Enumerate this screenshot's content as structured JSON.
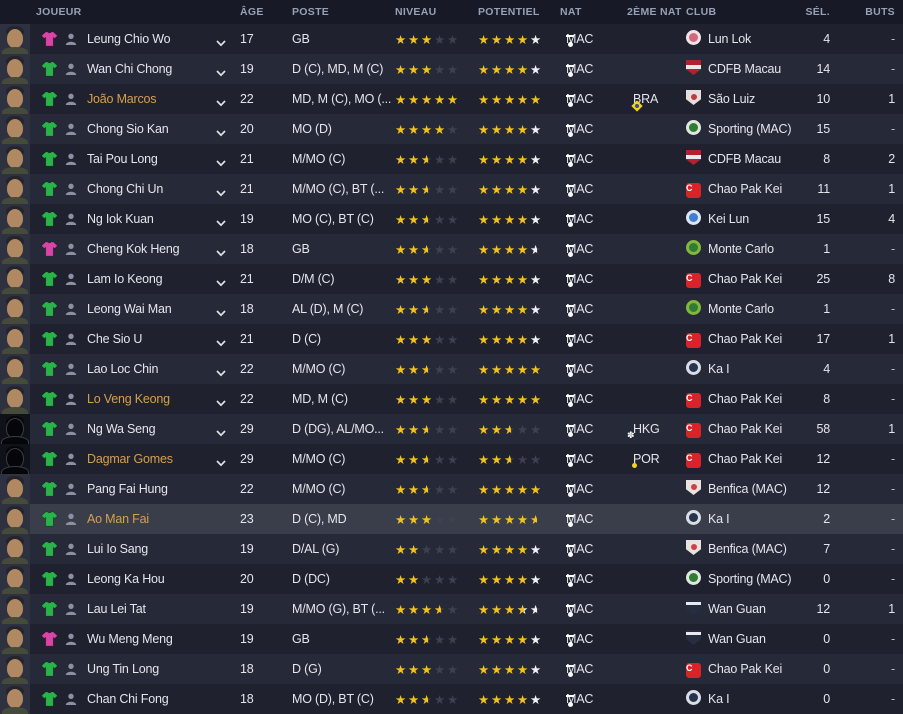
{
  "header": {
    "joueur": "JOUEUR",
    "age": "ÂGE",
    "poste": "POSTE",
    "niveau": "NIVEAU",
    "potentiel": "POTENTIEL",
    "nat": "NAT",
    "nat2": "2ÈME NAT",
    "club": "CLUB",
    "sel": "SÉL.",
    "buts": "BUTS"
  },
  "colors": {
    "gold_star": "#f2c21d",
    "white_star": "#f1f3f5",
    "empty_star": "#3d4150",
    "orange_name": "#d6a04b",
    "green_shirt": "#2ab34a",
    "pink_shirt": "#d944a7",
    "row_dark": "#1f212f",
    "row_light": "#262938",
    "row_highlight": "#3a3e4a",
    "header_bg": "#171926",
    "header_text": "#97a0b4",
    "text": "#e3e6ec"
  },
  "flags": {
    "MAC": {
      "bg": "#00795c"
    },
    "BRA": {
      "bg": "#0f9e49",
      "diamond": "#f7d117",
      "circle": "#2a4fa2"
    },
    "HKG": {
      "bg": "#d8232a"
    },
    "POR": {
      "green": "#0a6b3c",
      "red": "#d8232a",
      "circle": "#f7d117"
    }
  },
  "badges": {
    "lunlok": {
      "shape": "circle",
      "c1": "#efe3e6",
      "c2": "#d2687f"
    },
    "cdfb": {
      "shape": "shield",
      "c1": "#b3212e",
      "c2": "#e8e8ea"
    },
    "saoluiz": {
      "shape": "shield",
      "c1": "#e6dede",
      "c2": "#c23b3b",
      "center": true
    },
    "sporting": {
      "shape": "circle",
      "c1": "#dfe7df",
      "c2": "#2e7d32"
    },
    "cpk": {
      "shape": "square",
      "c1": "#d8232a",
      "glyph": "C"
    },
    "keilun": {
      "shape": "circle",
      "c1": "#dde6f0",
      "c2": "#3f7fd1"
    },
    "montecarlo": {
      "shape": "circle",
      "c1": "#84b53e",
      "c2": "#2e7d32"
    },
    "kai": {
      "shape": "circle",
      "c1": "#d8dde6",
      "c2": "#27344f"
    },
    "benfica": {
      "shape": "shield",
      "c1": "#e9e2df",
      "c2": "#cc4246",
      "center": true
    },
    "wanguan": {
      "shape": "shield",
      "c1": "#272d41",
      "c2": "#e8eaf0",
      "top": true
    }
  },
  "players": [
    {
      "name": "Leung Chio Wo",
      "name_style": "normal",
      "shirt": "pink",
      "portrait": "face",
      "dropdown": true,
      "age": "17",
      "poste": "GB",
      "niveau": [
        "g",
        "g",
        "g",
        "e",
        "e"
      ],
      "potentiel": [
        "g",
        "g",
        "g",
        "g",
        "w"
      ],
      "nat": "MAC",
      "nat2": "",
      "club": "Lun Lok",
      "badge": "lunlok",
      "sel": "4",
      "buts": "-",
      "highlighted": false
    },
    {
      "name": "Wan Chi Chong",
      "name_style": "normal",
      "shirt": "green",
      "portrait": "face",
      "dropdown": true,
      "age": "19",
      "poste": "D (C), MD, M (C)",
      "niveau": [
        "g",
        "g",
        "g",
        "e",
        "e"
      ],
      "potentiel": [
        "g",
        "g",
        "g",
        "g",
        "w"
      ],
      "nat": "MAC",
      "nat2": "",
      "club": "CDFB Macau",
      "badge": "cdfb",
      "sel": "14",
      "buts": "-",
      "highlighted": false
    },
    {
      "name": "João Marcos",
      "name_style": "orange",
      "shirt": "green",
      "portrait": "face",
      "dropdown": true,
      "age": "22",
      "poste": "MD, M (C), MO (...",
      "niveau": [
        "g",
        "g",
        "g",
        "g",
        "g"
      ],
      "potentiel": [
        "g",
        "g",
        "g",
        "g",
        "g"
      ],
      "nat": "MAC",
      "nat2": "BRA",
      "club": "São Luiz",
      "badge": "saoluiz",
      "sel": "10",
      "buts": "1",
      "highlighted": false
    },
    {
      "name": "Chong Sio Kan",
      "name_style": "normal",
      "shirt": "green",
      "portrait": "face",
      "dropdown": true,
      "age": "20",
      "poste": "MO (D)",
      "niveau": [
        "g",
        "g",
        "g",
        "g",
        "e"
      ],
      "potentiel": [
        "g",
        "g",
        "g",
        "g",
        "w"
      ],
      "nat": "MAC",
      "nat2": "",
      "club": "Sporting (MAC)",
      "badge": "sporting",
      "sel": "15",
      "buts": "-",
      "highlighted": false
    },
    {
      "name": "Tai Pou Long",
      "name_style": "normal",
      "shirt": "green",
      "portrait": "face",
      "dropdown": true,
      "age": "21",
      "poste": "M/MO (C)",
      "niveau": [
        "g",
        "g",
        "gh",
        "e",
        "e"
      ],
      "potentiel": [
        "g",
        "g",
        "g",
        "g",
        "w"
      ],
      "nat": "MAC",
      "nat2": "",
      "club": "CDFB Macau",
      "badge": "cdfb",
      "sel": "8",
      "buts": "2",
      "highlighted": false
    },
    {
      "name": "Chong Chi Un",
      "name_style": "normal",
      "shirt": "green",
      "portrait": "face",
      "dropdown": true,
      "age": "21",
      "poste": "M/MO (C), BT (...",
      "niveau": [
        "g",
        "g",
        "gh",
        "e",
        "e"
      ],
      "potentiel": [
        "g",
        "g",
        "g",
        "g",
        "w"
      ],
      "nat": "MAC",
      "nat2": "",
      "club": "Chao Pak Kei",
      "badge": "cpk",
      "sel": "11",
      "buts": "1",
      "highlighted": false
    },
    {
      "name": "Ng Iok Kuan",
      "name_style": "normal",
      "shirt": "green",
      "portrait": "face",
      "dropdown": true,
      "age": "19",
      "poste": "MO (C), BT (C)",
      "niveau": [
        "g",
        "g",
        "gh",
        "e",
        "e"
      ],
      "potentiel": [
        "g",
        "g",
        "g",
        "g",
        "w"
      ],
      "nat": "MAC",
      "nat2": "",
      "club": "Kei Lun",
      "badge": "keilun",
      "sel": "15",
      "buts": "4",
      "highlighted": false
    },
    {
      "name": "Cheng Kok Heng",
      "name_style": "normal",
      "shirt": "pink",
      "portrait": "face",
      "dropdown": true,
      "age": "18",
      "poste": "GB",
      "niveau": [
        "g",
        "g",
        "gh",
        "e",
        "e"
      ],
      "potentiel": [
        "g",
        "g",
        "g",
        "g",
        "wh"
      ],
      "nat": "MAC",
      "nat2": "",
      "club": "Monte Carlo",
      "badge": "montecarlo",
      "sel": "1",
      "buts": "-",
      "highlighted": false
    },
    {
      "name": "Lam Io Keong",
      "name_style": "normal",
      "shirt": "green",
      "portrait": "face",
      "dropdown": true,
      "age": "21",
      "poste": "D/M (C)",
      "niveau": [
        "g",
        "g",
        "g",
        "e",
        "e"
      ],
      "potentiel": [
        "g",
        "g",
        "g",
        "g",
        "w"
      ],
      "nat": "MAC",
      "nat2": "",
      "club": "Chao Pak Kei",
      "badge": "cpk",
      "sel": "25",
      "buts": "8",
      "highlighted": false
    },
    {
      "name": "Leong Wai Man",
      "name_style": "normal",
      "shirt": "green",
      "portrait": "face",
      "dropdown": true,
      "age": "18",
      "poste": "AL (D), M (C)",
      "niveau": [
        "g",
        "g",
        "gh",
        "e",
        "e"
      ],
      "potentiel": [
        "g",
        "g",
        "g",
        "g",
        "w"
      ],
      "nat": "MAC",
      "nat2": "",
      "club": "Monte Carlo",
      "badge": "montecarlo",
      "sel": "1",
      "buts": "-",
      "highlighted": false
    },
    {
      "name": "Che Sio U",
      "name_style": "normal",
      "shirt": "green",
      "portrait": "face",
      "dropdown": true,
      "age": "21",
      "poste": "D (C)",
      "niveau": [
        "g",
        "g",
        "g",
        "e",
        "e"
      ],
      "potentiel": [
        "g",
        "g",
        "g",
        "g",
        "w"
      ],
      "nat": "MAC",
      "nat2": "",
      "club": "Chao Pak Kei",
      "badge": "cpk",
      "sel": "17",
      "buts": "1",
      "highlighted": false
    },
    {
      "name": "Lao Loc Chin",
      "name_style": "normal",
      "shirt": "green",
      "portrait": "face",
      "dropdown": true,
      "age": "22",
      "poste": "M/MO (C)",
      "niveau": [
        "g",
        "g",
        "gh",
        "e",
        "e"
      ],
      "potentiel": [
        "g",
        "g",
        "g",
        "g",
        "g"
      ],
      "nat": "MAC",
      "nat2": "",
      "club": "Ka I",
      "badge": "kai",
      "sel": "4",
      "buts": "-",
      "highlighted": false
    },
    {
      "name": "Lo Veng Keong",
      "name_style": "orange",
      "shirt": "green",
      "portrait": "face",
      "dropdown": true,
      "age": "22",
      "poste": "MD, M (C)",
      "niveau": [
        "g",
        "g",
        "g",
        "e",
        "e"
      ],
      "potentiel": [
        "g",
        "g",
        "g",
        "g",
        "g"
      ],
      "nat": "MAC",
      "nat2": "",
      "club": "Chao Pak Kei",
      "badge": "cpk",
      "sel": "8",
      "buts": "-",
      "highlighted": false
    },
    {
      "name": "Ng Wa Seng",
      "name_style": "normal",
      "shirt": "green",
      "portrait": "silhouette",
      "dropdown": true,
      "age": "29",
      "poste": "D (DG), AL/MO...",
      "niveau": [
        "g",
        "g",
        "gh",
        "e",
        "e"
      ],
      "potentiel": [
        "g",
        "g",
        "gh",
        "e",
        "e"
      ],
      "nat": "MAC",
      "nat2": "HKG",
      "club": "Chao Pak Kei",
      "badge": "cpk",
      "sel": "58",
      "buts": "1",
      "highlighted": false
    },
    {
      "name": "Dagmar Gomes",
      "name_style": "orange",
      "shirt": "green",
      "portrait": "silhouette",
      "dropdown": true,
      "age": "29",
      "poste": "M/MO (C)",
      "niveau": [
        "g",
        "g",
        "gh",
        "e",
        "e"
      ],
      "potentiel": [
        "g",
        "g",
        "gh",
        "e",
        "e"
      ],
      "nat": "MAC",
      "nat2": "POR",
      "club": "Chao Pak Kei",
      "badge": "cpk",
      "sel": "12",
      "buts": "-",
      "highlighted": false
    },
    {
      "name": "Pang Fai Hung",
      "name_style": "normal",
      "shirt": "green",
      "portrait": "face",
      "dropdown": false,
      "age": "22",
      "poste": "M/MO (C)",
      "niveau": [
        "g",
        "g",
        "gh",
        "e",
        "e"
      ],
      "potentiel": [
        "g",
        "g",
        "g",
        "g",
        "g"
      ],
      "nat": "MAC",
      "nat2": "",
      "club": "Benfica (MAC)",
      "badge": "benfica",
      "sel": "12",
      "buts": "-",
      "highlighted": false
    },
    {
      "name": "Ao Man Fai",
      "name_style": "orange",
      "shirt": "green",
      "portrait": "face",
      "dropdown": false,
      "age": "23",
      "poste": "D (C), MD",
      "niveau": [
        "g",
        "g",
        "g",
        "e",
        "e"
      ],
      "potentiel": [
        "g",
        "g",
        "g",
        "g",
        "gh"
      ],
      "nat": "MAC",
      "nat2": "",
      "club": "Ka I",
      "badge": "kai",
      "sel": "2",
      "buts": "-",
      "highlighted": true
    },
    {
      "name": "Lui Io Sang",
      "name_style": "normal",
      "shirt": "green",
      "portrait": "face",
      "dropdown": false,
      "age": "19",
      "poste": "D/AL (G)",
      "niveau": [
        "g",
        "g",
        "e",
        "e",
        "e"
      ],
      "potentiel": [
        "g",
        "g",
        "g",
        "g",
        "w"
      ],
      "nat": "MAC",
      "nat2": "",
      "club": "Benfica (MAC)",
      "badge": "benfica",
      "sel": "7",
      "buts": "-",
      "highlighted": false
    },
    {
      "name": "Leong Ka Hou",
      "name_style": "normal",
      "shirt": "green",
      "portrait": "face",
      "dropdown": false,
      "age": "20",
      "poste": "D (DC)",
      "niveau": [
        "g",
        "g",
        "e",
        "e",
        "e"
      ],
      "potentiel": [
        "g",
        "g",
        "g",
        "g",
        "w"
      ],
      "nat": "MAC",
      "nat2": "",
      "club": "Sporting (MAC)",
      "badge": "sporting",
      "sel": "0",
      "buts": "-",
      "highlighted": false
    },
    {
      "name": "Lau Lei Tat",
      "name_style": "normal",
      "shirt": "green",
      "portrait": "face",
      "dropdown": false,
      "age": "19",
      "poste": "M/MO (G), BT (...",
      "niveau": [
        "g",
        "g",
        "g",
        "gh",
        "e"
      ],
      "potentiel": [
        "g",
        "g",
        "g",
        "gw",
        "wh"
      ],
      "nat": "MAC",
      "nat2": "",
      "club": "Wan Guan",
      "badge": "wanguan",
      "sel": "12",
      "buts": "1",
      "highlighted": false
    },
    {
      "name": "Wu Meng Meng",
      "name_style": "normal",
      "shirt": "pink",
      "portrait": "face",
      "dropdown": false,
      "age": "19",
      "poste": "GB",
      "niveau": [
        "g",
        "g",
        "gh",
        "e",
        "e"
      ],
      "potentiel": [
        "g",
        "g",
        "g",
        "g",
        "w"
      ],
      "nat": "MAC",
      "nat2": "",
      "club": "Wan Guan",
      "badge": "wanguan",
      "sel": "0",
      "buts": "-",
      "highlighted": false
    },
    {
      "name": "Ung Tin Long",
      "name_style": "normal",
      "shirt": "green",
      "portrait": "face",
      "dropdown": false,
      "age": "18",
      "poste": "D (G)",
      "niveau": [
        "g",
        "g",
        "g",
        "e",
        "e"
      ],
      "potentiel": [
        "g",
        "g",
        "g",
        "g",
        "w"
      ],
      "nat": "MAC",
      "nat2": "",
      "club": "Chao Pak Kei",
      "badge": "cpk",
      "sel": "0",
      "buts": "-",
      "highlighted": false
    },
    {
      "name": "Chan Chi Fong",
      "name_style": "normal",
      "shirt": "green",
      "portrait": "face",
      "dropdown": false,
      "age": "18",
      "poste": "MO (D), BT (C)",
      "niveau": [
        "g",
        "g",
        "gh",
        "e",
        "e"
      ],
      "potentiel": [
        "g",
        "g",
        "g",
        "g",
        "w"
      ],
      "nat": "MAC",
      "nat2": "",
      "club": "Ka I",
      "badge": "kai",
      "sel": "0",
      "buts": "-",
      "highlighted": false
    }
  ]
}
